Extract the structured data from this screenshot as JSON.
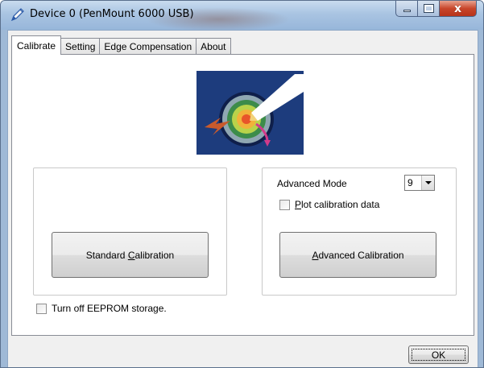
{
  "window": {
    "title": "Device 0 (PenMount 6000 USB)",
    "icon": "pen-icon",
    "caption_buttons": [
      "minimize",
      "maximize",
      "close"
    ],
    "close_glyph": "x"
  },
  "tabs": [
    {
      "label": "Calibrate",
      "active": true
    },
    {
      "label": "Setting",
      "active": false
    },
    {
      "label": "Edge Compensation",
      "active": false
    },
    {
      "label": "About",
      "active": false
    }
  ],
  "calibrate": {
    "logo": "calibration-target-logo",
    "standard_button": {
      "pre": "Standard ",
      "accel": "C",
      "post": "alibration"
    },
    "advanced": {
      "mode_label": "Advanced Mode",
      "mode_value": "9",
      "plot_checkbox": {
        "accel": "P",
        "post": "lot calibration data",
        "checked": false
      },
      "button": {
        "pre": "",
        "accel": "A",
        "post": "dvanced Calibration"
      }
    },
    "eeprom_checkbox": {
      "label": "Turn off EEPROM storage.",
      "checked": false
    }
  },
  "footer": {
    "ok_label": "OK"
  },
  "colors": {
    "titlebar": "#a9c4e2",
    "close_button": "#c8462b",
    "logo_background": "#1d3c7d",
    "dialog_background": "#f0f0f0"
  }
}
